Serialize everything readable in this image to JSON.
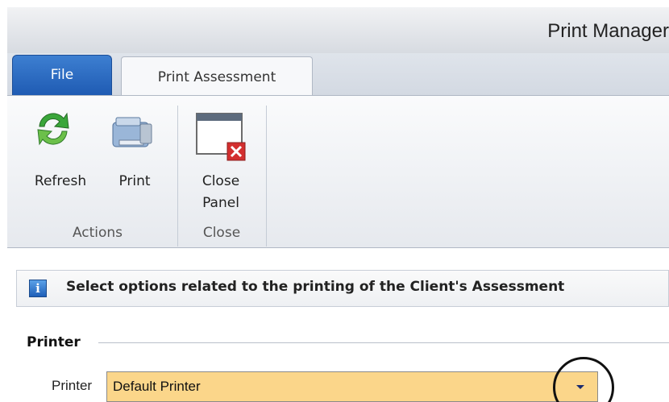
{
  "window": {
    "title": "Print Manager"
  },
  "tabs": {
    "file": "File",
    "active": "Print Assessment"
  },
  "ribbon": {
    "groups": [
      {
        "label": "Actions",
        "buttons": [
          {
            "label": "Refresh",
            "icon": "refresh-icon"
          },
          {
            "label": "Print",
            "icon": "printer-icon"
          }
        ]
      },
      {
        "label": "Close",
        "buttons": [
          {
            "label_line1": "Close",
            "label_line2": "Panel",
            "icon": "close-panel-icon"
          }
        ]
      }
    ]
  },
  "info": {
    "text": "Select options related to the printing of the Client's Assessment",
    "icon": "info-icon"
  },
  "printer_section": {
    "title": "Printer",
    "field_label": "Printer",
    "value": "Default Printer",
    "highlight_color": "#fbd68a"
  },
  "colors": {
    "file_tab": "#1f5bb3",
    "close_badge": "#d32f2f"
  }
}
